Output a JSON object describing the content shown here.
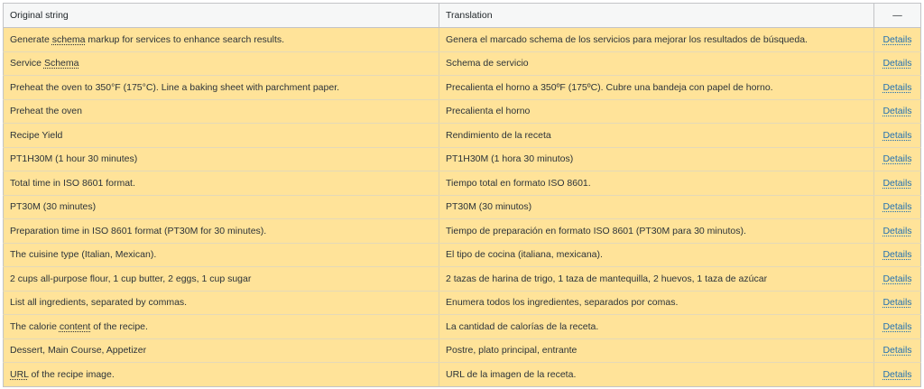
{
  "header": {
    "original": "Original string",
    "translation": "Translation",
    "actions": "—"
  },
  "details_label": "Details",
  "rows": [
    {
      "pre": "Generate ",
      "glossary": "schema",
      "post": " markup for services to enhance search results.",
      "translation": "Genera el marcado schema de los servicios para mejorar los resultados de búsqueda."
    },
    {
      "pre": "Service ",
      "glossary": "Schema",
      "post": "",
      "translation": "Schema de servicio"
    },
    {
      "pre": "Preheat the oven to 350°F (175°C). Line a baking sheet with parchment paper.",
      "glossary": "",
      "post": "",
      "translation": "Precalienta el horno a 350ºF (175ºC). Cubre una bandeja con papel de horno."
    },
    {
      "pre": "Preheat the oven",
      "glossary": "",
      "post": "",
      "translation": "Precalienta el horno"
    },
    {
      "pre": "Recipe Yield",
      "glossary": "",
      "post": "",
      "translation": "Rendimiento de la receta"
    },
    {
      "pre": "PT1H30M (1 hour 30 minutes)",
      "glossary": "",
      "post": "",
      "translation": "PT1H30M (1 hora 30 minutos)"
    },
    {
      "pre": "Total time in ISO 8601 format.",
      "glossary": "",
      "post": "",
      "translation": "Tiempo total en formato ISO 8601."
    },
    {
      "pre": "PT30M (30 minutes)",
      "glossary": "",
      "post": "",
      "translation": "PT30M (30 minutos)"
    },
    {
      "pre": "Preparation time in ISO 8601 format (PT30M for 30 minutes).",
      "glossary": "",
      "post": "",
      "translation": "Tiempo de preparación en formato ISO 8601 (PT30M para 30 minutos)."
    },
    {
      "pre": "The cuisine type (Italian, Mexican).",
      "glossary": "",
      "post": "",
      "translation": "El tipo de cocina (italiana, mexicana)."
    },
    {
      "pre": "2 cups all-purpose flour, 1 cup butter, 2 eggs, 1 cup sugar",
      "glossary": "",
      "post": "",
      "translation": "2 tazas de harina de trigo, 1 taza de mantequilla, 2 huevos, 1 taza de azúcar"
    },
    {
      "pre": "List all ingredients, separated by commas.",
      "glossary": "",
      "post": "",
      "translation": "Enumera todos los ingredientes, separados por comas."
    },
    {
      "pre": "The calorie ",
      "glossary": "content",
      "post": " of the recipe.",
      "translation": "La cantidad de calorías de la receta."
    },
    {
      "pre": "Dessert, Main Course, Appetizer",
      "glossary": "",
      "post": "",
      "translation": "Postre, plato principal, entrante"
    },
    {
      "pre": "",
      "glossary": "URL",
      "post": " of the recipe image.",
      "translation": "URL de la imagen de la receta."
    }
  ]
}
